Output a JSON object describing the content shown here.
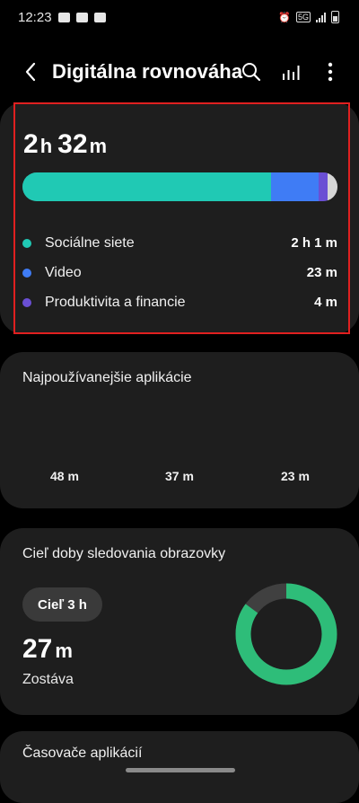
{
  "status_bar": {
    "time": "12:23",
    "network": "5G"
  },
  "header": {
    "title": "Digitálna rovnováha",
    "back_icon": "chevron-left-icon",
    "actions": [
      "search-icon",
      "bar-chart-icon",
      "more-vert-icon"
    ]
  },
  "usage": {
    "total_hours": "2",
    "hours_unit": "h",
    "total_minutes": "32",
    "minutes_unit": "m",
    "segments_fraction": [
      {
        "category": "Sociálne siete",
        "fraction": 0.79,
        "color": "#20c9b4"
      },
      {
        "category": "Video",
        "fraction": 0.15,
        "color": "#3f7cf5"
      },
      {
        "category": "Produktivita a financie",
        "fraction": 0.03,
        "color": "#6a4fd4"
      },
      {
        "category": "other",
        "fraction": 0.03,
        "color": "#d6d6d6"
      }
    ],
    "categories": [
      {
        "label": "Sociálne siete",
        "value": "2 h 1 m",
        "color": "#20c9b4"
      },
      {
        "label": "Video",
        "value": "23 m",
        "color": "#3f7cf5"
      },
      {
        "label": "Produktivita a financie",
        "value": "4 m",
        "color": "#6a4fd4"
      }
    ]
  },
  "top_apps": {
    "title": "Najpoužívanejšie aplikácie",
    "times": [
      "48 m",
      "37 m",
      "23 m"
    ]
  },
  "screen_time_goal": {
    "title": "Cieľ doby sledovania obrazovky",
    "goal_label": "Cieľ 3 h",
    "remaining_value": "27",
    "remaining_unit": "m",
    "remaining_label": "Zostáva",
    "progress_fraction": 0.85,
    "progress_color": "#2ebd79",
    "track_color": "#404040"
  },
  "app_timers": {
    "title": "Časovače aplikácií"
  }
}
